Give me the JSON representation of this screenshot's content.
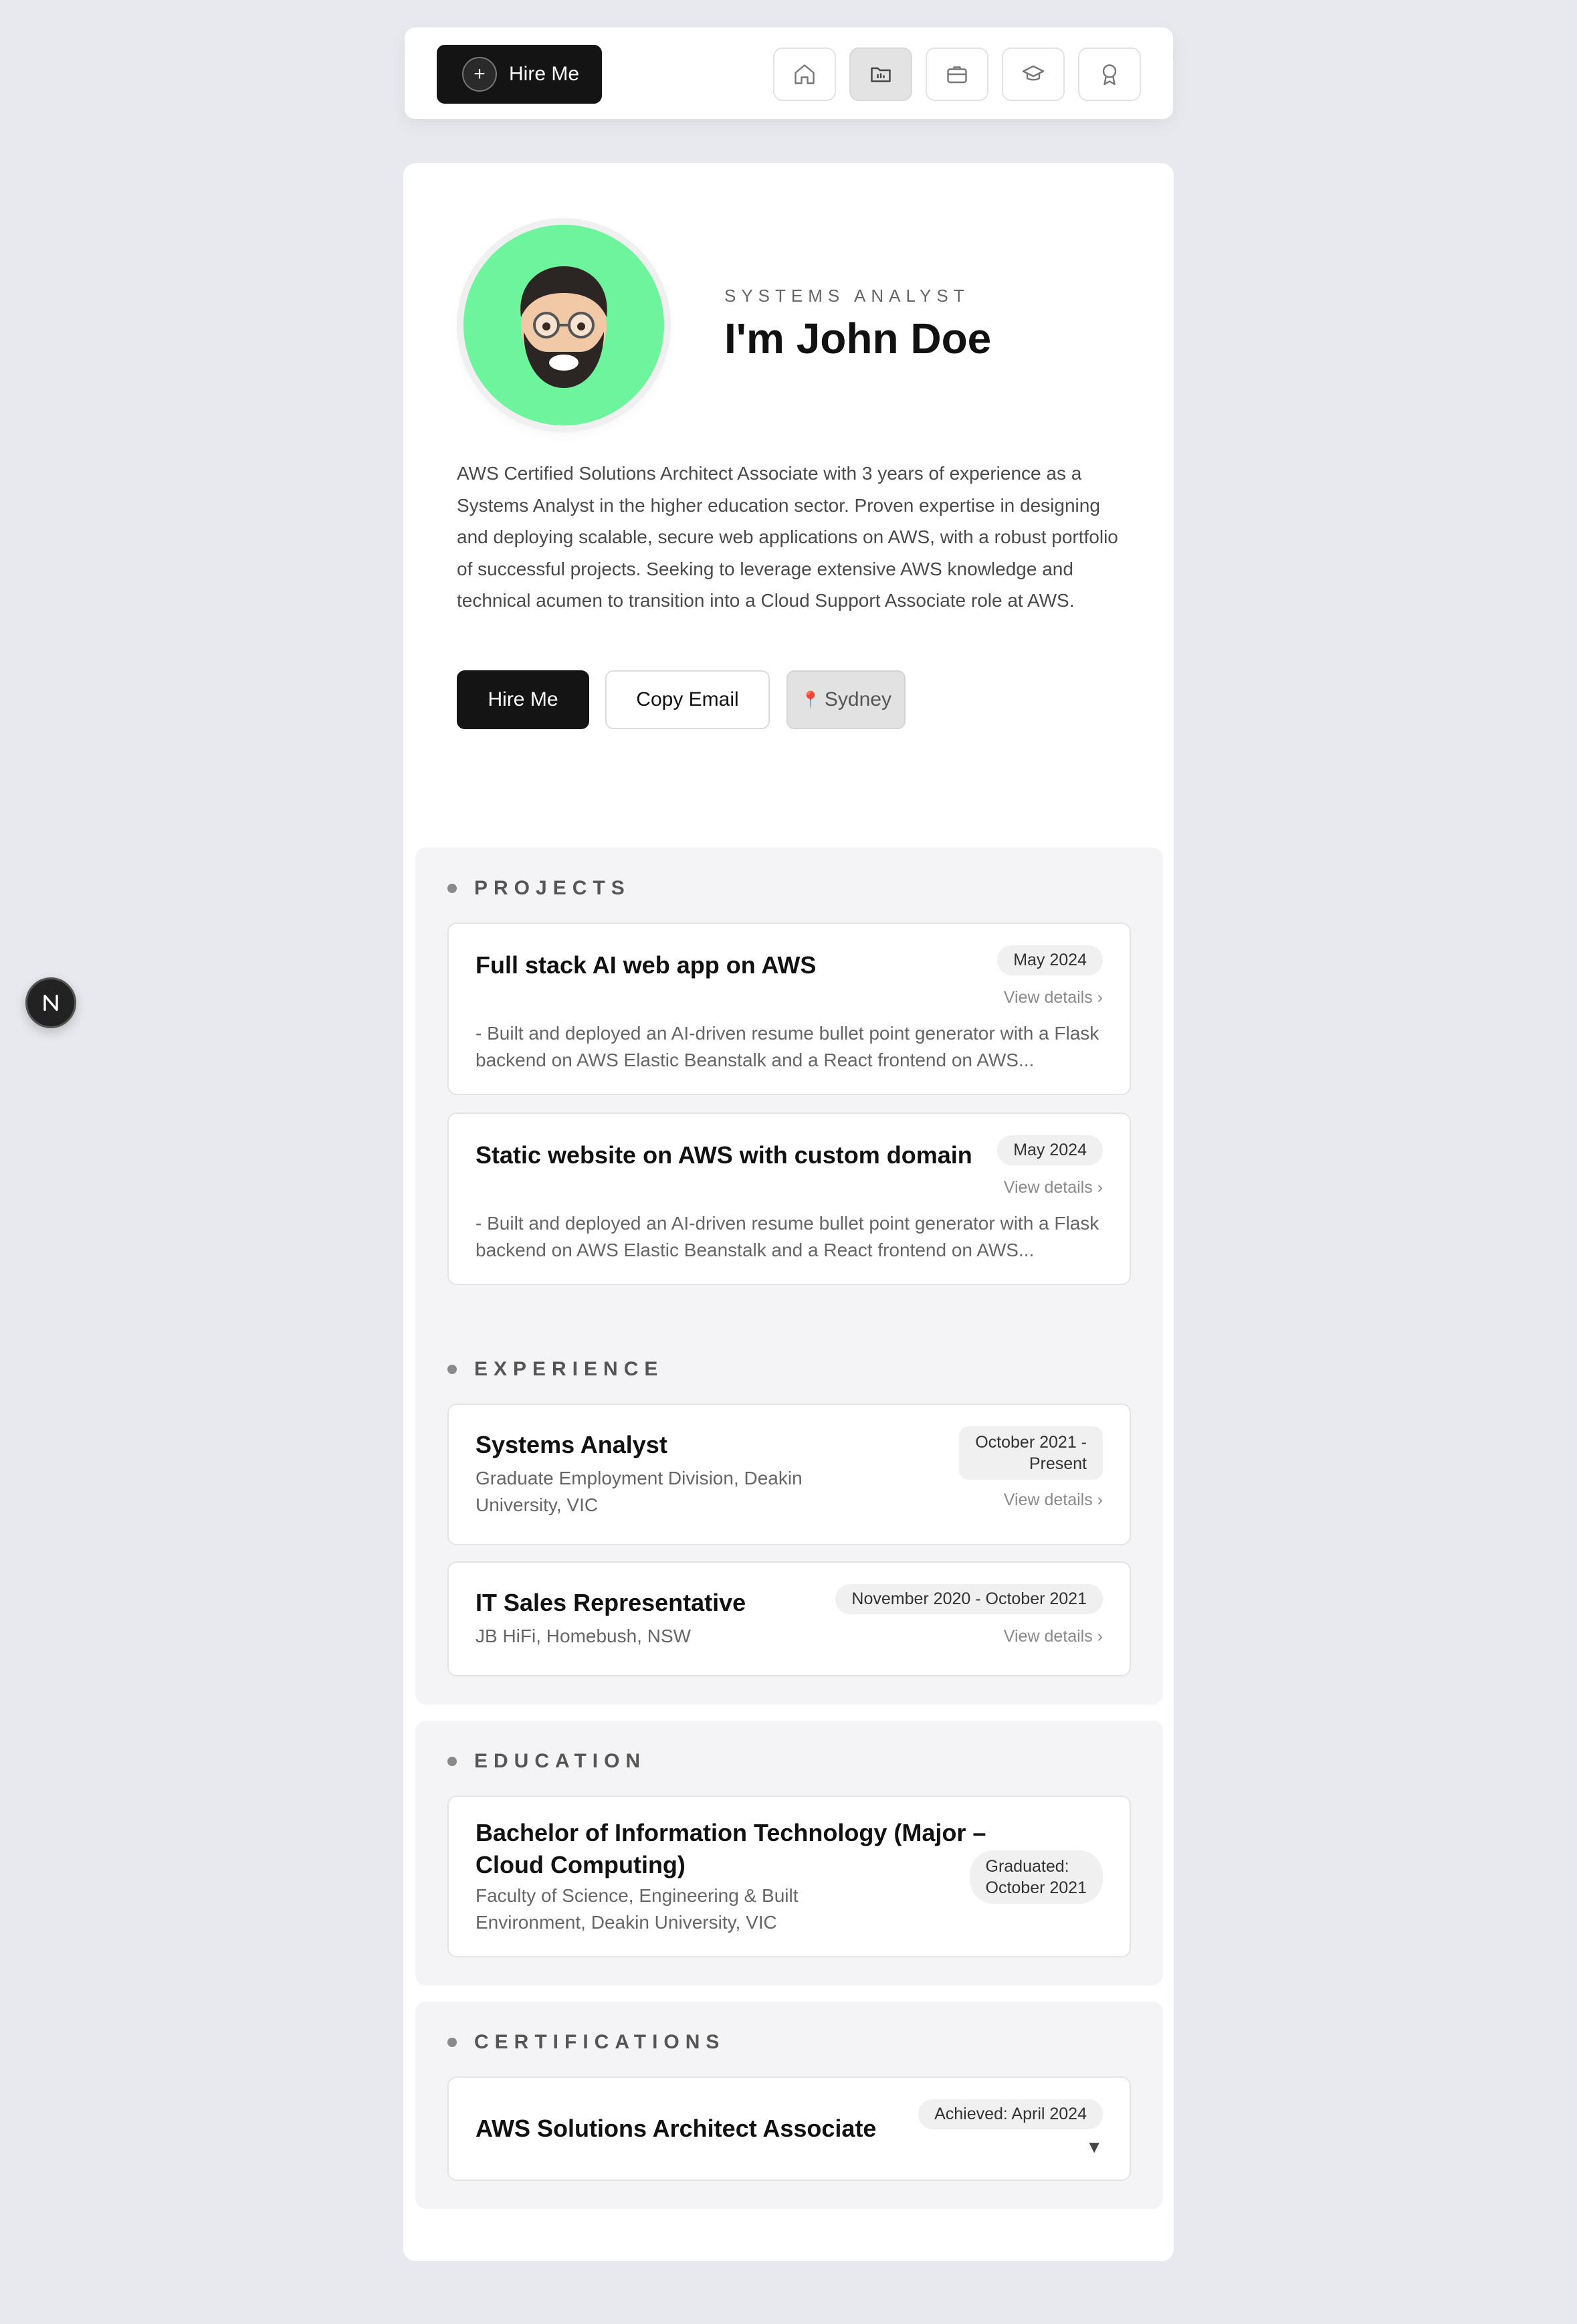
{
  "topbar": {
    "hire_label": "Hire Me",
    "nav": [
      {
        "icon": "home-icon"
      },
      {
        "icon": "projects-folder-icon",
        "active": true
      },
      {
        "icon": "briefcase-icon"
      },
      {
        "icon": "graduation-cap-icon"
      },
      {
        "icon": "award-icon"
      }
    ]
  },
  "profile": {
    "role": "SYSTEMS ANALYST",
    "name": "I'm John Doe",
    "bio": "AWS Certified Solutions Architect Associate with 3 years of experience as a Systems Analyst in the higher education sector. Proven expertise in designing and deploying scalable, secure web applications on AWS, with a robust portfolio of successful projects. Seeking to leverage extensive AWS knowledge and technical acumen to transition into a Cloud Support Associate role at AWS.",
    "hire_button": "Hire Me",
    "copy_email_button": "Copy Email",
    "location": "Sydney",
    "avatar_bg": "#6ef49c"
  },
  "projects": {
    "title": "PROJECTS",
    "items": [
      {
        "title": "Full stack AI web app on AWS",
        "date": "May 2024",
        "view": "View details",
        "desc": "- Built and deployed an AI-driven resume bullet point generator with a Flask backend on AWS Elastic Beanstalk and a React frontend on AWS..."
      },
      {
        "title": "Static website on AWS with custom domain",
        "date": "May 2024",
        "view": "View details",
        "desc": "- Built and deployed an AI-driven resume bullet point generator with a Flask backend on AWS Elastic Beanstalk and a React frontend on AWS..."
      }
    ]
  },
  "experience": {
    "title": "EXPERIENCE",
    "items": [
      {
        "title": "Systems Analyst",
        "org_line1": "Graduate Employment Division, Deakin",
        "org_line2": "University, VIC",
        "date_line1": "October 2021 -",
        "date_line2": "Present",
        "view": "View details"
      },
      {
        "title": "IT Sales Representative",
        "org": "JB HiFi, Homebush, NSW",
        "date": "November 2020 - October 2021",
        "view": "View details"
      }
    ]
  },
  "education": {
    "title": "EDUCATION",
    "items": [
      {
        "title_line1": "Bachelor of Information Technology (Major –",
        "title_line2": "Cloud Computing)",
        "org_line1": "Faculty of Science, Engineering & Built",
        "org_line2": "Environment, Deakin University, VIC",
        "date_line1": "Graduated:",
        "date_line2": "October 2021"
      }
    ]
  },
  "certifications": {
    "title": "CERTIFICATIONS",
    "items": [
      {
        "title": "AWS Solutions Architect Associate",
        "date": "Achieved: April 2024",
        "toggle": "▼"
      }
    ]
  },
  "floating_badge": {
    "letter": "N"
  }
}
